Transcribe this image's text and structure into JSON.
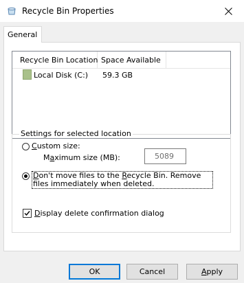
{
  "window": {
    "title": "Recycle Bin Properties",
    "close_glyph": "✕"
  },
  "tabs": [
    {
      "label": "General"
    }
  ],
  "list": {
    "columns": [
      "Recycle Bin Location",
      "Space Available"
    ],
    "rows": [
      {
        "location": "Local Disk (C:)",
        "space": "59.3 GB"
      }
    ]
  },
  "settings": {
    "group_label": "Settings for selected location",
    "custom_size": {
      "label_prefix": "",
      "label_mnemonic": "C",
      "label_rest": "ustom size:",
      "checked": false
    },
    "max_size": {
      "label_prefix": "M",
      "label_mnemonic": "a",
      "label_rest": "ximum size (MB):",
      "value": "5089"
    },
    "dont_move": {
      "label_prefix": "",
      "label_mnemonic": "D",
      "label_mid": "on't move files to the ",
      "label_mnemonic2": "R",
      "label_rest": "ecycle Bin. Remove files immediately when deleted.",
      "checked": true
    },
    "confirm_dialog": {
      "label_prefix": "",
      "label_mnemonic": "D",
      "label_rest": "isplay delete confirmation dialog",
      "checked": true
    }
  },
  "buttons": {
    "ok": "OK",
    "cancel": "Cancel",
    "apply_mnemonic": "A",
    "apply_rest": "pply"
  },
  "colors": {
    "drive_icon": "#a9c18a",
    "default_button_border": "#0078d7"
  }
}
